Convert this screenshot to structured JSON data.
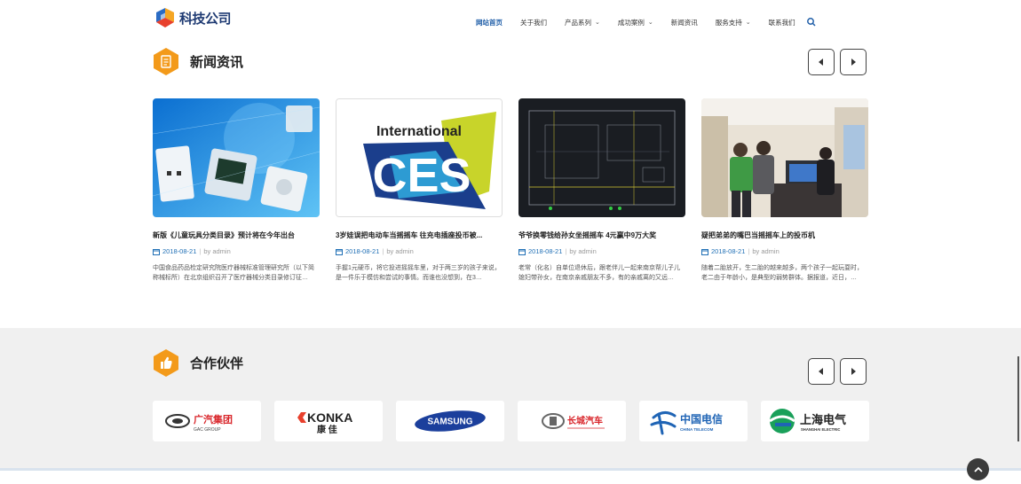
{
  "brand": {
    "name": "科技公司"
  },
  "nav": {
    "items": [
      {
        "label": "网站首页",
        "active": true,
        "dropdown": false
      },
      {
        "label": "关于我们",
        "active": false,
        "dropdown": false
      },
      {
        "label": "产品系列",
        "active": false,
        "dropdown": true
      },
      {
        "label": "成功案例",
        "active": false,
        "dropdown": true
      },
      {
        "label": "新闻资讯",
        "active": false,
        "dropdown": false
      },
      {
        "label": "服务支持",
        "active": false,
        "dropdown": true
      },
      {
        "label": "联系我们",
        "active": false,
        "dropdown": false
      }
    ],
    "search_icon": "search-icon"
  },
  "news": {
    "title": "新闻资讯",
    "icon": "document-icon",
    "items": [
      {
        "title": "新版《儿童玩具分类目录》预计将在今年出台",
        "date": "2018-08-21",
        "author": "by admin",
        "desc": "中国食品药品检定研究院医疗器械标准管理研究所（以下简称械标所）在北京组织召开了医疗器械分类目录修订征…"
      },
      {
        "title": "3岁娃误把电动车当摇摇车 往充电插座投币被...",
        "date": "2018-08-21",
        "author": "by admin",
        "desc": "手握1元硬币，将它投进摇摇车里，对于两三岁的孩子来说，是一件乐于模仿和尝试的事情。而谁也没想到，在3…"
      },
      {
        "title": "爷爷换零钱给孙女坐摇摇车 4元赢中9万大奖",
        "date": "2018-08-21",
        "author": "by admin",
        "desc": "老常（化名）自单位退休后，跟老伴儿一起来南京帮儿子儿媳妇带孙女，在南京亲戚朋友不多，有的亲戚离的又远…"
      },
      {
        "title": "疑把弟弟的嘴巴当摇摇车上的投币机",
        "date": "2018-08-21",
        "author": "by admin",
        "desc": "随着二胎放开，生二胎的越来越多，两个孩子一起玩耍时，老二由于年龄小，是典型的弱势群体。据报道，近日，…"
      }
    ],
    "thumb_ces": {
      "line1": "International",
      "line2": "CES"
    }
  },
  "partners": {
    "title": "合作伙伴",
    "icon": "thumbs-up-icon",
    "logos": [
      {
        "name": "广汽集团",
        "sub": "GAC GROUP"
      },
      {
        "name": "KONKA",
        "sub": "康 佳"
      },
      {
        "name": "SAMSUNG",
        "sub": ""
      },
      {
        "name": "长城汽车",
        "sub": ""
      },
      {
        "name": "中国电信",
        "sub": "CHINA TELECOM"
      },
      {
        "name": "上海电气",
        "sub": "SHANGHAI ELECTRIC"
      }
    ]
  },
  "colors": {
    "accent_orange": "#f39a1a",
    "nav_active": "#1f5ea8",
    "link_blue": "#1f6fb5"
  }
}
